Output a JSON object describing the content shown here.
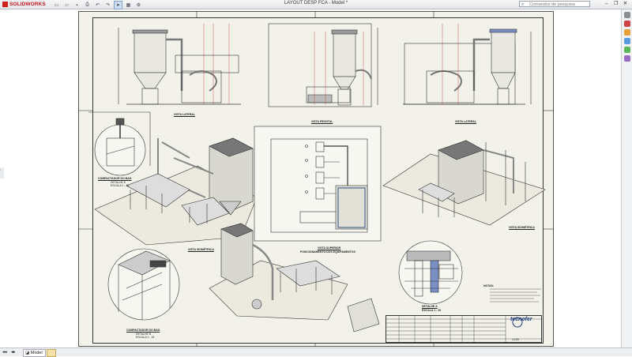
{
  "app": {
    "brand": "SOLIDWORKS",
    "doc_title": "LAYOUT DESP FCA - Model *"
  },
  "search": {
    "placeholder": "Comandos de pesquisa"
  },
  "window_buttons": {
    "minimize": "–",
    "restore": "❐",
    "close": "✕"
  },
  "quick_access": [
    "new-icon",
    "open-icon",
    "save-icon",
    "print-icon",
    "undo-icon",
    "redo-icon",
    "select-icon",
    "rebuild-icon",
    "options-icon"
  ],
  "views": {
    "side_left": "VISTA LATERAL",
    "front": "VISTA FRONTAL",
    "side_right": "VISTA LATERAL",
    "compactador_top": "COMPACTADOR DO BAG",
    "compactador_top_sub": "DETALHE E\nESCALA 1 : 15",
    "iso_left": "VISTA ISOMÉTRICA",
    "top": "VISTA SUPERIOR",
    "top_sub": "POSICIONAMENTO DOS EQUIPAMENTOS",
    "iso_right": "VISTA ISOMÉTRICA",
    "compactador_bottom": "COMPACTADOR DO BAG",
    "compactador_bottom_sub": "DETALHE B\nESCALA 1 : 15",
    "detail_a": "DETALHE A",
    "detail_a_sub": "ESCALA 1 : 30"
  },
  "notes": {
    "head": "NOTAS:"
  },
  "titleblock": {
    "company": "tecnofer",
    "scale": "1:100"
  },
  "tabs": {
    "model": "Model",
    "layout_icon": "layout-tab-icon"
  },
  "colors": {
    "accent": "#1b3d78",
    "brand_red": "#c4161c",
    "sheet": "#f3f2ea",
    "line": "#333333"
  }
}
